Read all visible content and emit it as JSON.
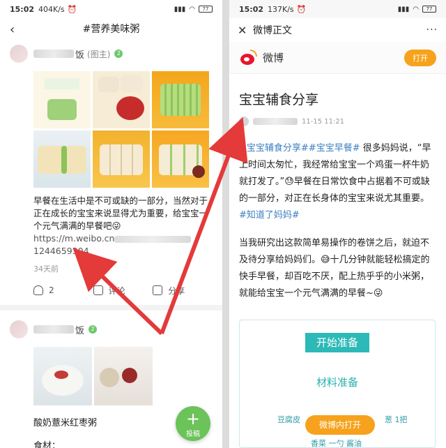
{
  "left": {
    "status": {
      "time": "15:02",
      "speed": "404K/s",
      "battery": "77"
    },
    "nav": {
      "title": "#营养美味粥"
    },
    "post1": {
      "name_suffix": "饭",
      "role": "(图主)",
      "level": "2",
      "text": "早餐在生活中是不可或缺的一部分，当然对于正在成长的宝宝来说显得尤为重要，给宝宝一个元气满满的早餐吧😜",
      "link_start": "https://m.weibo.cn",
      "link_end": "1244659304",
      "time": "34天前",
      "likes": "2",
      "comment_label": "评论",
      "share_label": "分享"
    },
    "post2": {
      "name_suffix": "饭",
      "level": "2",
      "title": "酸奶薏米红枣粥",
      "ingredient_label": "食材："
    },
    "fab": {
      "plus": "+",
      "label": "投稿"
    }
  },
  "right": {
    "status": {
      "time": "15:02",
      "speed": "137K/s",
      "battery": "77"
    },
    "topbar": {
      "title": "微博正文",
      "more": "···"
    },
    "weibo": {
      "name": "微博",
      "open_label": "打开"
    },
    "article": {
      "title": "宝宝辅食分享",
      "date": "11-15 11:21",
      "tag1": "#宝宝辅食分享#",
      "tag2": "#宝宝早餐#",
      "body1": " 很多妈妈说，“早上时间太匆忙，我经常给宝宝一个鸡蛋一杯牛奶就打发了。”😓早餐在日常饮食中占据着不可或缺的一部分，对正在长身体的宝宝来说尤其重要。",
      "tag3": "#知道了妈妈#",
      "body2": "当我研究出这款简单易操作的卷饼之后，就迫不及待分享给妈妈们。😅十几分钟就能轻松搞定的快手早餐，却百吃不厌，配上热乎乎的小米粥，就能给宝宝一个元气满满的早餐~😜"
    },
    "card": {
      "start_label": "开始准备",
      "materials_title": "材料准备",
      "material_line": "豆腐皮",
      "material_qty": "葱 1把",
      "material_line2": "香菜 一勺 酱油"
    },
    "weibo_open_button": "微博内打开"
  },
  "colors": {
    "accent_red": "#e43a3a",
    "weibo_orange": "#f7a21c",
    "teal": "#2cb9b8",
    "fab_green": "#6bc35a"
  }
}
